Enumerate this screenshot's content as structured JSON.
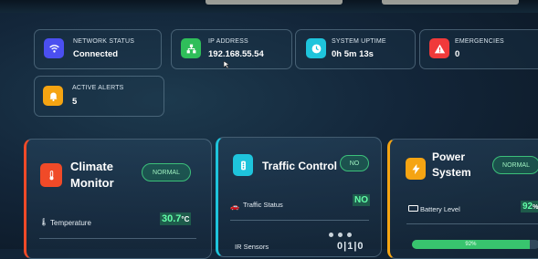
{
  "stats": {
    "network": {
      "label": "NETWORK STATUS",
      "value": "Connected",
      "icon": "wifi-icon",
      "color": "#4b4ff0"
    },
    "ip": {
      "label": "IP ADDRESS",
      "value": "192.168.55.54",
      "icon": "network-icon",
      "color": "#2fbe5a"
    },
    "uptime": {
      "label": "SYSTEM UPTIME",
      "value": "0h 5m 13s",
      "icon": "clock-icon",
      "color": "#1ec4dc"
    },
    "emergencies": {
      "label": "EMERGENCIES",
      "value": "0",
      "icon": "warning-icon",
      "color": "#f03a3a"
    },
    "alerts": {
      "label": "ACTIVE ALERTS",
      "value": "5",
      "icon": "bell-icon",
      "color": "#f5a412"
    }
  },
  "climate": {
    "title_line1": "Climate",
    "title_line2": "Monitor",
    "badge": "NORMAL",
    "rows": [
      {
        "label": "Temperature",
        "value": "30.7",
        "unit": "°C"
      }
    ],
    "accent": "#f04a28"
  },
  "traffic": {
    "title": "Traffic Control",
    "badge": "NO",
    "rows": [
      {
        "label": "Traffic Status",
        "value": "NO"
      },
      {
        "label": "IR Sensors",
        "value": "0|1|0"
      }
    ],
    "accent": "#1ec4dc"
  },
  "power": {
    "title_line1": "Power",
    "title_line2": "System",
    "badge": "NORMAL",
    "rows": [
      {
        "label": "Battery Level",
        "value": "92",
        "unit": "%"
      }
    ],
    "progress": {
      "label": "92%",
      "fraction": 0.92
    },
    "accent": "#f5a412"
  }
}
